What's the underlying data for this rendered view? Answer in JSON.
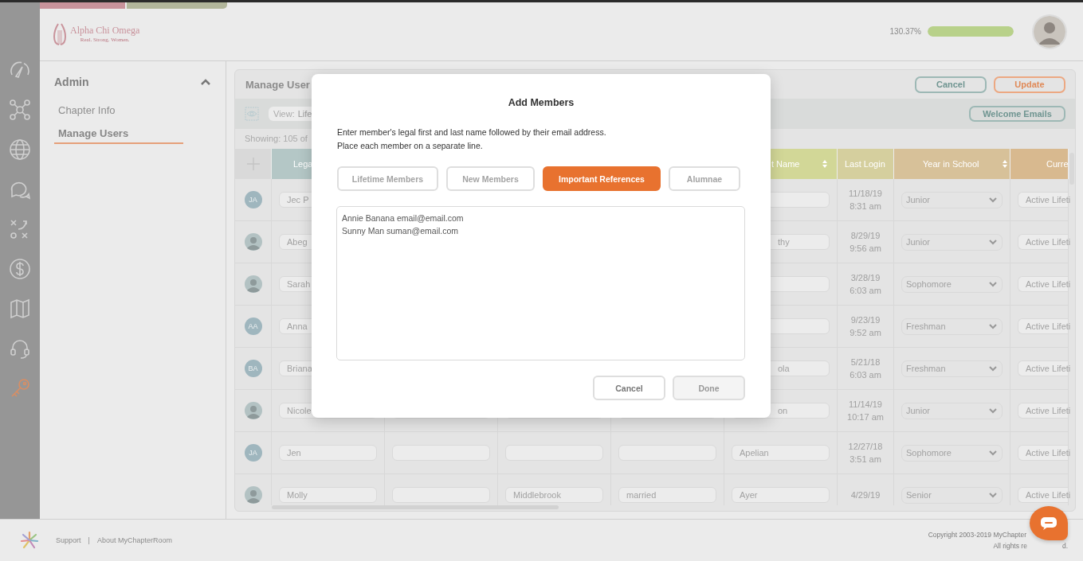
{
  "rail": [
    {
      "selected": false
    },
    {
      "selected": false
    },
    {
      "selected": false
    },
    {
      "selected": false
    },
    {
      "selected": false
    },
    {
      "selected": false
    },
    {
      "selected": false
    },
    {
      "selected": false
    },
    {
      "selected": true
    }
  ],
  "header": {
    "logo_name": "Alpha Chi Omega",
    "logo_tagline": "Real. Strong. Women.",
    "progress_reading": "130.37%",
    "progress": {
      "level": 1
    }
  },
  "sidebar": {
    "section": "Admin",
    "expanded": true,
    "items": [
      {
        "label": "Chapter Info",
        "selected": false
      },
      {
        "label": "Manage Users",
        "selected": true
      }
    ]
  },
  "panel": {
    "title": "Manage User",
    "buttons": [
      {
        "label": "Cancel",
        "kind": "secondary"
      },
      {
        "label": "Update",
        "kind": "primary"
      }
    ],
    "view_label": "View:",
    "view_value": "Life",
    "welcome_button": "Welcome Emails",
    "showing": "Showing: 105 of"
  },
  "table": {
    "columns": [
      {
        "kind": "add"
      },
      {
        "kind": "plain",
        "label": "Lega",
        "color": "#b4c7c6"
      },
      {
        "kind": "plain"
      },
      {
        "kind": "plain"
      },
      {
        "kind": "plain"
      },
      {
        "kind": "plain",
        "label": "t Name",
        "color": "#d2d797",
        "sortable": true
      },
      {
        "kind": "plain",
        "label": "Last Login",
        "color": "#d5cf9e"
      },
      {
        "kind": "plain",
        "label": "Year in School",
        "color": "#d7c199",
        "sortable": true
      },
      {
        "kind": "plain",
        "label": "Curre",
        "color": "#d8b98f"
      }
    ],
    "rows": [
      {
        "avatar": {
          "kind": "initials",
          "initials": "JA"
        },
        "first": "Jec P",
        "login_date": "11/18/19",
        "login_time": "8:31 am",
        "year": "Junior",
        "status": "Active Lifeti"
      },
      {
        "avatar": {
          "kind": "photo"
        },
        "first": "Abeg",
        "last": "thy",
        "login_date": "8/29/19",
        "login_time": "9:56 am",
        "year": "Junior",
        "status": "Active Lifeti"
      },
      {
        "avatar": {
          "kind": "photo"
        },
        "first": "Sarah",
        "login_date": "3/28/19",
        "login_time": "6:03 am",
        "year": "Sophomore",
        "status": "Active Lifeti"
      },
      {
        "avatar": {
          "kind": "initials",
          "initials": "AA"
        },
        "first": "Anna",
        "login_date": "9/23/19",
        "login_time": "9:52 am",
        "year": "Freshman",
        "status": "Active Lifeti"
      },
      {
        "avatar": {
          "kind": "initials",
          "initials": "BA"
        },
        "first": "Briana",
        "last": "ola",
        "login_date": "5/21/18",
        "login_time": "6:03 am",
        "year": "Freshman",
        "status": "Active Lifeti"
      },
      {
        "avatar": {
          "kind": "photo"
        },
        "first": "Nicole",
        "last": "on",
        "login_date": "11/14/19",
        "login_time": "10:17 am",
        "year": "Junior",
        "status": "Active Lifeti"
      },
      {
        "avatar": {
          "kind": "initials",
          "initials": "JA"
        },
        "first": "Jen",
        "last": "Apelian",
        "login_date": "12/27/18",
        "login_time": "3:51 am",
        "year": "Sophomore",
        "status": "Active Lifeti"
      },
      {
        "avatar": {
          "kind": "photo"
        },
        "first": "Molly",
        "col_4": "Middlebrook",
        "col_5": "married",
        "last": "Ayer",
        "login_date": "4/29/19",
        "year": "Senior",
        "status": "Active Lifeti"
      }
    ]
  },
  "modal": {
    "title": "Add Members",
    "instructions": [
      "Enter member's legal first and last name followed by their email address.",
      "Place each member on a separate line."
    ],
    "tabs": [
      {
        "label": "Lifetime Members",
        "selected": false
      },
      {
        "label": "New Members",
        "selected": false
      },
      {
        "label": "Important References",
        "selected": true
      },
      {
        "label": "Alumnae",
        "selected": false
      }
    ],
    "entry": "Annie Banana email@email.com\nSunny Man suman@email.com",
    "buttons": [
      {
        "label": "Cancel",
        "kind": "secondary"
      },
      {
        "label": "Done",
        "kind": "done"
      }
    ]
  },
  "footer": {
    "links": [
      {
        "label": "Support"
      },
      {
        "label": "About MyChapterRoom"
      }
    ],
    "separator": "|",
    "copyright": "Copyright 2003-2019 MyChapter",
    "rights": [
      "All rights re",
      "d."
    ]
  }
}
